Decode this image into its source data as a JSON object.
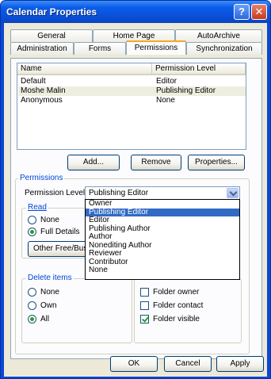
{
  "window": {
    "title": "Calendar Properties"
  },
  "tabs": {
    "row1": [
      "General",
      "Home Page",
      "AutoArchive"
    ],
    "row2": [
      "Administration",
      "Forms",
      "Permissions",
      "Synchronization"
    ]
  },
  "list": {
    "columns": [
      "Name",
      "Permission Level"
    ],
    "rows": [
      {
        "name": "Default",
        "level": "Editor"
      },
      {
        "name": "Moshe Malin",
        "level": "Publishing Editor"
      },
      {
        "name": "Anonymous",
        "level": "None"
      }
    ]
  },
  "buttons": {
    "add": "Add...",
    "remove": "Remove",
    "properties": "Properties...",
    "ok": "OK",
    "cancel": "Cancel",
    "apply": "Apply"
  },
  "permissions": {
    "group_label": "Permissions",
    "level_label": "Permission Level:",
    "level_value": "Publishing Editor",
    "options": [
      "Owner",
      "Publishing Editor",
      "Editor",
      "Publishing Author",
      "Author",
      "Nonediting Author",
      "Reviewer",
      "Contributor",
      "None"
    ],
    "selected_option": "Publishing Editor"
  },
  "read": {
    "label": "Read",
    "none": "None",
    "full_details": "Full Details",
    "other_button": "Other Free/Bus"
  },
  "delete_items": {
    "label": "Delete items",
    "none": "None",
    "own": "Own",
    "all": "All"
  },
  "other": {
    "folder_owner": "Folder owner",
    "folder_contact": "Folder contact",
    "folder_visible": "Folder visible"
  },
  "colors": {
    "title_bar": "#0a50d8",
    "selection": "#316ac5",
    "group_label": "#0046d5"
  }
}
